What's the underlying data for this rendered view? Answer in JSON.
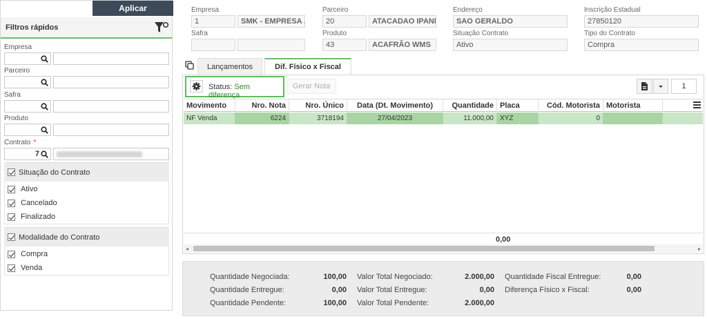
{
  "filters": {
    "apply_label": "Aplicar",
    "title": "Filtros rápidos",
    "fields": [
      {
        "label": "Empresa",
        "code": "",
        "required": false
      },
      {
        "label": "Parceiro",
        "code": "",
        "required": false
      },
      {
        "label": "Safra",
        "code": "",
        "required": false
      },
      {
        "label": "Produto",
        "code": "",
        "required": false
      },
      {
        "label": "Contrato",
        "code": "7",
        "required": true,
        "required_mark": "*"
      }
    ],
    "groups": [
      {
        "title": "Situação do Contrato",
        "options": [
          "Ativo",
          "Cancelado",
          "Finalizado"
        ]
      },
      {
        "title": "Modalidade do Contrato",
        "options": [
          "Compra",
          "Venda"
        ]
      }
    ]
  },
  "header": {
    "empresa": {
      "label": "Empresa",
      "code": "1",
      "name": "SMK - EMPRESA A"
    },
    "parceiro": {
      "label": "Parceiro",
      "code": "20",
      "name": "ATACADAO IPANE"
    },
    "endereco": {
      "label": "Endereço",
      "value": "SAO GERALDO"
    },
    "inscricao": {
      "label": "Inscrição Estadual",
      "value": "27850120"
    },
    "safra": {
      "label": "Safra",
      "code": "",
      "name": ""
    },
    "produto": {
      "label": "Produto",
      "code": "43",
      "name": "ACAFRÃO WMS"
    },
    "situacao": {
      "label": "Situação Contrato",
      "value": "Ativo"
    },
    "tipo": {
      "label": "Tipo do Contrato",
      "value": "Compra"
    }
  },
  "tabs": [
    {
      "label": "Lançamentos",
      "active": false
    },
    {
      "label": "Dif. Físico x Fiscal",
      "active": true
    }
  ],
  "toolbar": {
    "status_label": "Status:",
    "status_value": "Sem diferença",
    "gerar_label": "Gerar Nota",
    "page": "1"
  },
  "table": {
    "columns": [
      "Movimento",
      "Nro. Nota",
      "Nro. Único",
      "Data (Dt. Movimento)",
      "Quantidade",
      "Placa",
      "Cód. Motorista",
      "Motorista"
    ],
    "rows": [
      [
        "NF Venda",
        "6224",
        "3718194",
        "27/04/2023",
        "11.000,00",
        "XYZ",
        "0",
        ""
      ]
    ],
    "total_quantidade": "0,00"
  },
  "summary": {
    "col1": [
      {
        "label": "Quantidade Negociada:",
        "value": "100,00"
      },
      {
        "label": "Quantidade Entregue:",
        "value": "0,00"
      },
      {
        "label": "Quantidade Pendente:",
        "value": "100,00"
      }
    ],
    "col2": [
      {
        "label": "Valor Total Negociado:",
        "value": "2.000,00"
      },
      {
        "label": "Valor Total Entregue:",
        "value": "0,00"
      },
      {
        "label": "Valor Total Pendente:",
        "value": "2.000,00"
      }
    ],
    "col3": [
      {
        "label": "Quantidade Fiscal Entregue:",
        "value": "0,00"
      },
      {
        "label": "Diferença Físico x Fiscal:",
        "value": "0,00"
      }
    ]
  },
  "colors": {
    "accent": "#6dbb6d",
    "apply_bg": "#3c4a59",
    "row_selected": "#c9e6c6",
    "status_green": "#2e8b2e"
  }
}
